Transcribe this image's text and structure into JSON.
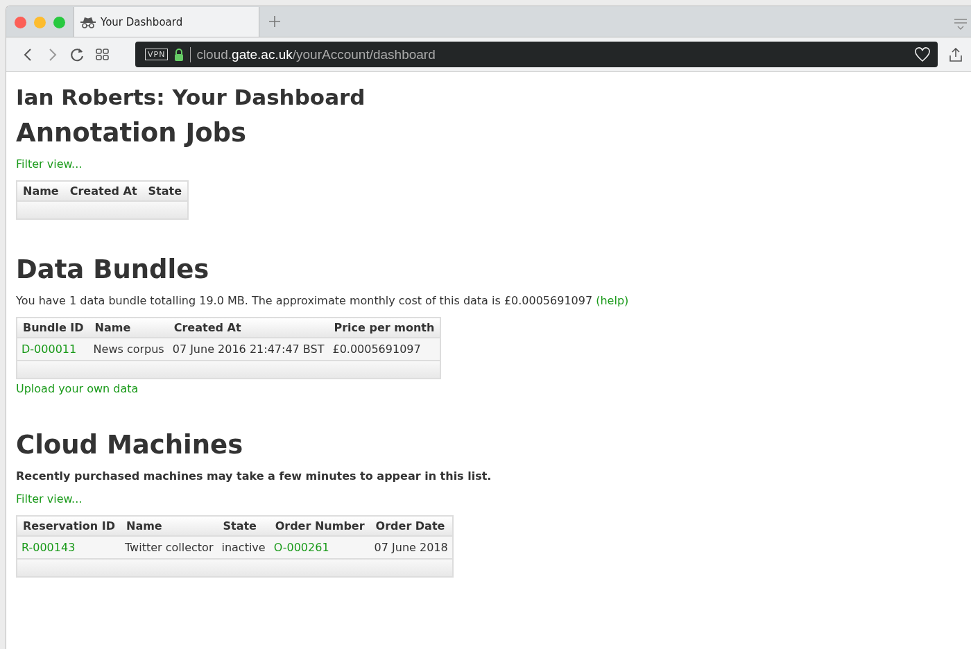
{
  "browser": {
    "tabs": [
      {
        "label": "Your Dashboard",
        "selected": true
      }
    ],
    "address": {
      "vpn": "VPN",
      "host_prefix": "cloud.",
      "host": "gate.ac.uk",
      "path": "/yourAccount/dashboard"
    }
  },
  "page": {
    "title": "Ian Roberts: Your Dashboard",
    "sections": [
      {
        "heading": "Annotation Jobs",
        "links_before": [
          "Filter view..."
        ],
        "table": {
          "columns": [
            "Name",
            "Created At",
            "State"
          ]
        }
      },
      {
        "heading": "Data Bundles",
        "text": "You have 1 data bundle totalling 19.0 MB. The approximate monthly cost of this data is £0.0005691097",
        "text_link": "(help)",
        "table": {
          "columns": [
            "Bundle ID",
            "Name",
            "Created At",
            "Price per month"
          ],
          "rows": [
            [
              {
                "text": "D-000011",
                "kind": "link"
              },
              {
                "text": "News corpus",
                "kind": "text"
              },
              {
                "text": "07 June 2016 21:47:47 BST",
                "kind": "text"
              },
              {
                "text": "£0.0005691097",
                "kind": "text"
              }
            ]
          ]
        },
        "links_after": [
          "Upload your own data"
        ]
      },
      {
        "heading": "Cloud Machines",
        "note": "Recently purchased machines may take a few minutes to appear in this list.",
        "links_before": [
          "Filter view..."
        ],
        "table": {
          "columns": [
            "Reservation ID",
            "Name",
            "State",
            "Order Number",
            "Order Date"
          ],
          "rows": [
            [
              {
                "text": "R-000143",
                "kind": "link"
              },
              {
                "text": "Twitter collector",
                "kind": "text"
              },
              {
                "text": "inactive",
                "kind": "text"
              },
              {
                "text": "O-000261",
                "kind": "link"
              },
              {
                "text": "07 June 2018",
                "kind": "text"
              }
            ]
          ]
        }
      }
    ]
  }
}
